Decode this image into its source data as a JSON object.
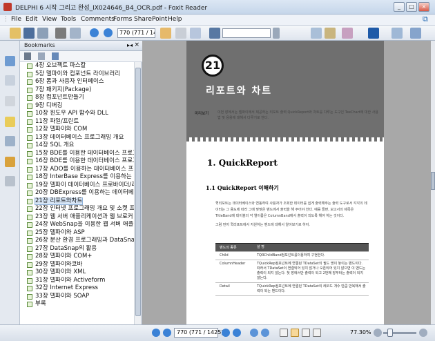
{
  "window": {
    "title": "DELPHI 6 시작 그리고 완성_IX024646_B4_OCR.pdf - Foxit Reader"
  },
  "menu": [
    "File",
    "Edit",
    "View",
    "Tools",
    "Comments",
    "Forms",
    "SharePoint",
    "Help"
  ],
  "toolbar": {
    "page_value": "770 (771 / 142"
  },
  "bookmarks": {
    "title": "Bookmarks",
    "items": [
      {
        "label": "4장 오브젝트 파스칼"
      },
      {
        "label": "5장 델파이와 컴포넌트 라이브러리"
      },
      {
        "label": "6장 폼과 사용자 인터페이스"
      },
      {
        "label": "7장 패키지(Package)"
      },
      {
        "label": "8장 컴포넌트만들기"
      },
      {
        "label": "9장 디버깅"
      },
      {
        "label": "10장 윈도우 API 함수와 DLL"
      },
      {
        "label": "11장 파일/프린트"
      },
      {
        "label": "12장 델파이와 COM"
      },
      {
        "label": "13장 데이터베이스 프로그래밍 개요"
      },
      {
        "label": "14장 SQL 개요"
      },
      {
        "label": "15장 BDE를 이용한 데이터베이스 프로그"
      },
      {
        "label": "16장 BDE를 이용한 데이터베이스 프로그"
      },
      {
        "label": "17장 ADO를 이용하는 데이터베이스 프"
      },
      {
        "label": "18장 InterBase Express를 이용하는 데이"
      },
      {
        "label": "19장 델파이 데이터베이스 프로바이더/리"
      },
      {
        "label": "20장 DBExpress를 이용하는 데이터베이"
      },
      {
        "label": "21장 리포트와차트",
        "selected": true
      },
      {
        "label": "22장 인터넷 프로그래밍 개요 및 소켓 프"
      },
      {
        "label": "23장 웹 서버 애플리케이션과 웹 브로커"
      },
      {
        "label": "24장 WebSnap을 이용한 웹 서버 애플리"
      },
      {
        "label": "25장 델파이와 ASP"
      },
      {
        "label": "26장 분산 환경 프로그래밍과 DataSnap"
      },
      {
        "label": "27장 DataSnap의 활용"
      },
      {
        "label": "28장 델파이와 COM+"
      },
      {
        "label": "29장 델파이와코바"
      },
      {
        "label": "30장 델파이와 XML"
      },
      {
        "label": "31장 델파이와 Activeform"
      },
      {
        "label": "32장 Internet Express"
      },
      {
        "label": "33장 델파이와 SOAP"
      },
      {
        "label": "부록"
      }
    ]
  },
  "page": {
    "chapter_number": "21",
    "chapter_title": "리포트와 차트",
    "intro_label": "미리보기",
    "intro_text": "이번 장에서는 델파이에서 제공하는 리포트 출력 QuickReport와 차트를 다루는 도구인 TeeChart에 대한 사용법 및 응용에 대해서 다루기로 한다.",
    "heading1": "1. QuickReport",
    "heading2": "1.1 QuickReport 이해하기",
    "paragraph": "퀵리포트는 데이터베이스와 연동하여 사용자가 조회한 데이터를 쉽게 출력해주는 출력 도구로서 각각의 데이터는 그 용도에 따라 그에 맞맞은 밴드에서 출력을 해 주어야 한다. 예를 들면, 보고서의 제목은 TitleBand에 데이블의 각 열이름은 ColumnBand에서 출력이 되도록 해야 하는 것이다.",
    "paragraph2": "그럼 먼저 퀵리포트에서 지원하는 밴드에 대해서 알아보기로 하자.",
    "table": {
      "headers": [
        "밴드의 종류",
        "설 명"
      ],
      "rows": [
        [
          "Child",
          "TQRChildBand컴포넌트를이용하여 구현한다."
        ],
        [
          "ColumnHeader",
          "TQuickRep컴포넌트에 연결된 TDataSet의 필드 명이 놓이는 밴드이다. 따라서 TDataSet이 연결되어 있지 않거나 오픈되어 있지 않으면 이 밴드는 출력이 되지 않는다. 첫 장에서만 출력이 되고 2번째 장부터는 출력이 되지 않는다."
        ],
        [
          "Detail",
          "TQuickRep컴포넌트에 연결된 TDataSet의 레코드 개수 만큼 반복해서 출력이 되는 밴드이다."
        ]
      ]
    }
  },
  "status": {
    "page_value": "770 (771 / 1425)",
    "zoom": "77.30%"
  }
}
